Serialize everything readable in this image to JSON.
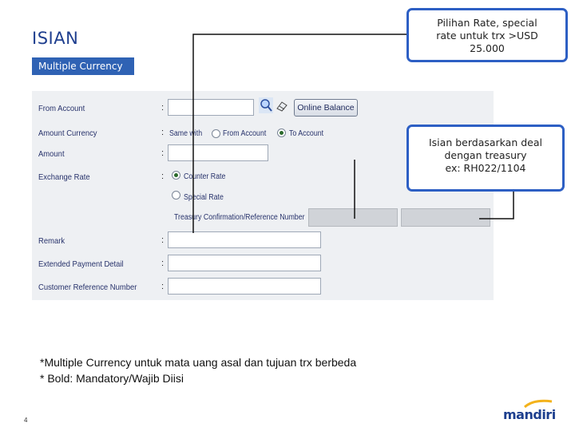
{
  "slide": {
    "title": "ISIAN",
    "section_tab": "Multiple Currency",
    "page_number": "4",
    "brand": "mandiri"
  },
  "form": {
    "colon": ":",
    "from_account": {
      "label": "From Account",
      "value": "",
      "button": "Online Balance"
    },
    "amount_currency": {
      "label": "Amount Currency",
      "option_same_with": "Same with",
      "option_from": "From Account",
      "option_to": "To Account",
      "selected": "To Account"
    },
    "amount": {
      "label": "Amount",
      "value": ""
    },
    "exchange_rate": {
      "label": "Exchange Rate",
      "option_counter": "Counter Rate",
      "option_special": "Special Rate",
      "selected": "Counter Rate",
      "treasury_label": "Treasury Confirmation/Reference Number"
    },
    "remark": {
      "label": "Remark",
      "value": ""
    },
    "extended_payment_detail": {
      "label": "Extended Payment Detail",
      "value": ""
    },
    "customer_reference_number": {
      "label": "Customer Reference Number",
      "value": ""
    }
  },
  "callouts": {
    "rate_choice": {
      "line1": "Pilihan Rate, special",
      "line2": "rate untuk trx >USD",
      "line3": "25.000"
    },
    "treasury_deal": {
      "line1": "Isian berdasarkan deal",
      "line2": "dengan treasury",
      "line3": "ex: RH022/1104"
    }
  },
  "footnote": {
    "line1": "*Multiple Currency untuk mata uang asal dan tujuan trx berbeda",
    "line2": "* Bold: Mandatory/Wajib Diisi"
  },
  "colors": {
    "accent": "#2d5fc4",
    "title": "#1f3f8f",
    "tab": "#2f62b4",
    "panel": "#eef0f3"
  }
}
